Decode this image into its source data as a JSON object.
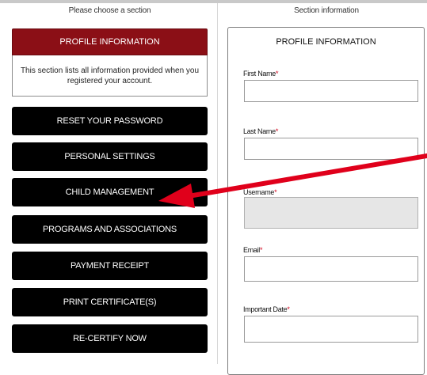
{
  "left_column": {
    "header": "Please choose a section",
    "profile_section": {
      "title": "PROFILE INFORMATION",
      "description": "This section lists all information provided when you registered your account."
    },
    "menu": [
      {
        "label": "RESET YOUR PASSWORD"
      },
      {
        "label": "PERSONAL SETTINGS"
      },
      {
        "label": "CHILD MANAGEMENT"
      },
      {
        "label": "PROGRAMS AND ASSOCIATIONS"
      },
      {
        "label": "PAYMENT RECEIPT"
      },
      {
        "label": "PRINT CERTIFICATE(S)"
      },
      {
        "label": "RE-CERTIFY NOW"
      }
    ]
  },
  "right_column": {
    "header": "Section information",
    "panel_title": "PROFILE INFORMATION",
    "fields": [
      {
        "label": "First Name",
        "required_mark": "*",
        "value": ""
      },
      {
        "label": "Last Name",
        "required_mark": "*",
        "value": ""
      },
      {
        "label": "Username",
        "required_mark": "*",
        "value": ""
      },
      {
        "label": "Email",
        "required_mark": "*",
        "value": ""
      },
      {
        "label": "Important Date",
        "required_mark": "*",
        "value": ""
      }
    ]
  },
  "colors": {
    "profile_header_bg": "#8b0f16",
    "menu_button_bg": "#000000",
    "annotation_arrow": "#e0001b",
    "required_mark": "#d0021b"
  }
}
